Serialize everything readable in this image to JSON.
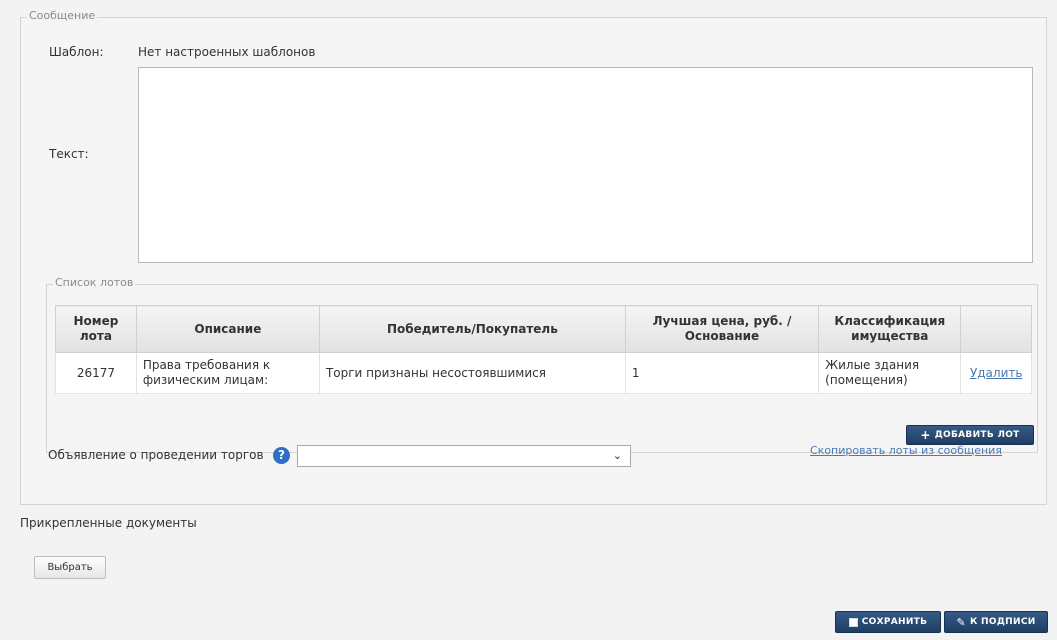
{
  "message": {
    "legend": "Сообщение",
    "template_label": "Шаблон:",
    "template_value": "Нет настроенных шаблонов",
    "text_label": "Текст:",
    "text_value": ""
  },
  "lots": {
    "legend": "Список лотов",
    "columns": [
      "Номер лота",
      "Описание",
      "Победитель/Покупатель",
      "Лучшая цена, руб. / Основание",
      "Классификация имущества",
      ""
    ],
    "rows": [
      {
        "number": "26177",
        "description": "Права требования к физическим лицам:",
        "winner": "Торги признаны несостоявшимися",
        "price": "1",
        "classification": "Жилые здания (помещения)",
        "action": "Удалить"
      }
    ],
    "add_button": "добавить лот",
    "copy_link": "Скопировать лоты из сообщения"
  },
  "announcement": {
    "label": "Объявление о проведении торгов",
    "help_icon": "?",
    "selected": ""
  },
  "documents": {
    "label": "Прикрепленные документы",
    "choose_button": "Выбрать"
  },
  "actions": {
    "save": "сохранить",
    "sign": "к подписи"
  }
}
